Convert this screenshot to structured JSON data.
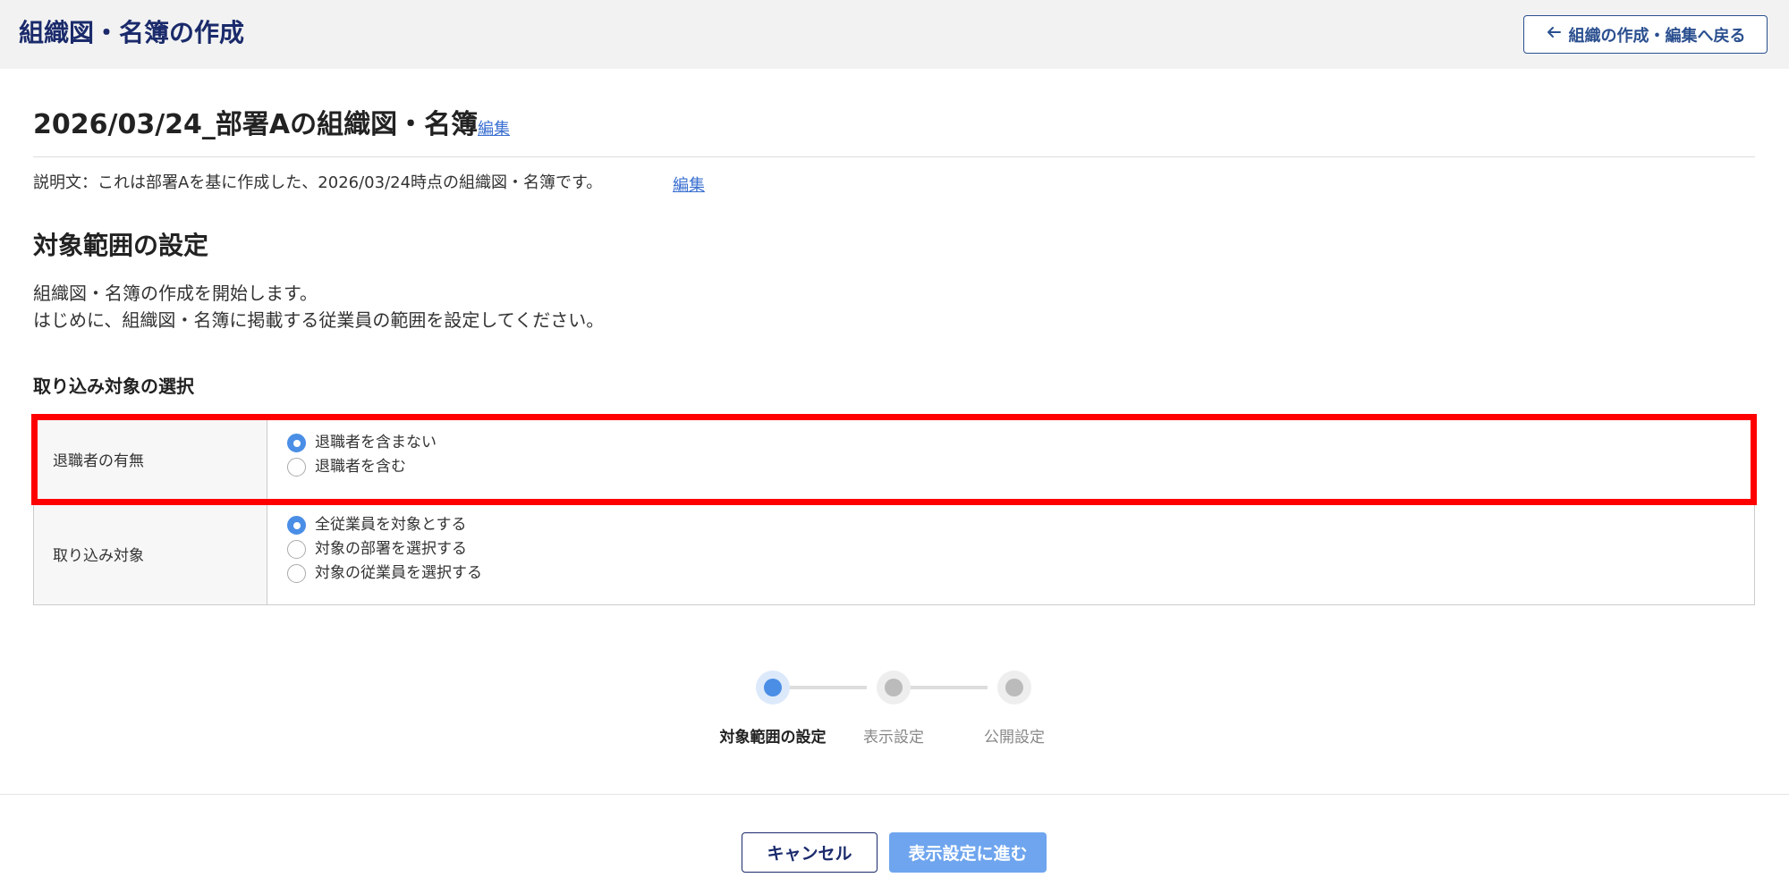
{
  "header": {
    "title": "組織図・名簿の作成",
    "back_label": "組織の作成・編集へ戻る"
  },
  "document": {
    "title": "2026/03/24_部署Aの組織図・名簿",
    "edit_label": "編集",
    "description": "説明文：これは部署Aを基に作成した、2026/03/24時点の組織図・名簿です。",
    "description_edit_label": "編集"
  },
  "section": {
    "title": "対象範囲の設定",
    "intro_line1": "組織図・名簿の作成を開始します。",
    "intro_line2": "はじめに、組織図・名簿に掲載する従業員の範囲を設定してください。",
    "subsection_title": "取り込み対象の選択"
  },
  "settings": {
    "retired": {
      "label": "退職者の有無",
      "options": [
        "退職者を含まない",
        "退職者を含む"
      ],
      "selected_index": 0
    },
    "target": {
      "label": "取り込み対象",
      "options": [
        "全従業員を対象とする",
        "対象の部署を選択する",
        "対象の従業員を選択する"
      ],
      "selected_index": 0
    }
  },
  "stepper": {
    "steps": [
      "対象範囲の設定",
      "表示設定",
      "公開設定"
    ],
    "current_index": 0
  },
  "footer": {
    "cancel_label": "キャンセル",
    "next_label": "表示設定に進む"
  },
  "colors": {
    "accent": "#4a8ee6",
    "navy": "#1a2a6b",
    "highlight": "#ff0000"
  },
  "icons": {
    "back": "arrow-left-icon",
    "radio_checked": "radio-checked-icon",
    "radio_unchecked": "radio-unchecked-icon"
  }
}
